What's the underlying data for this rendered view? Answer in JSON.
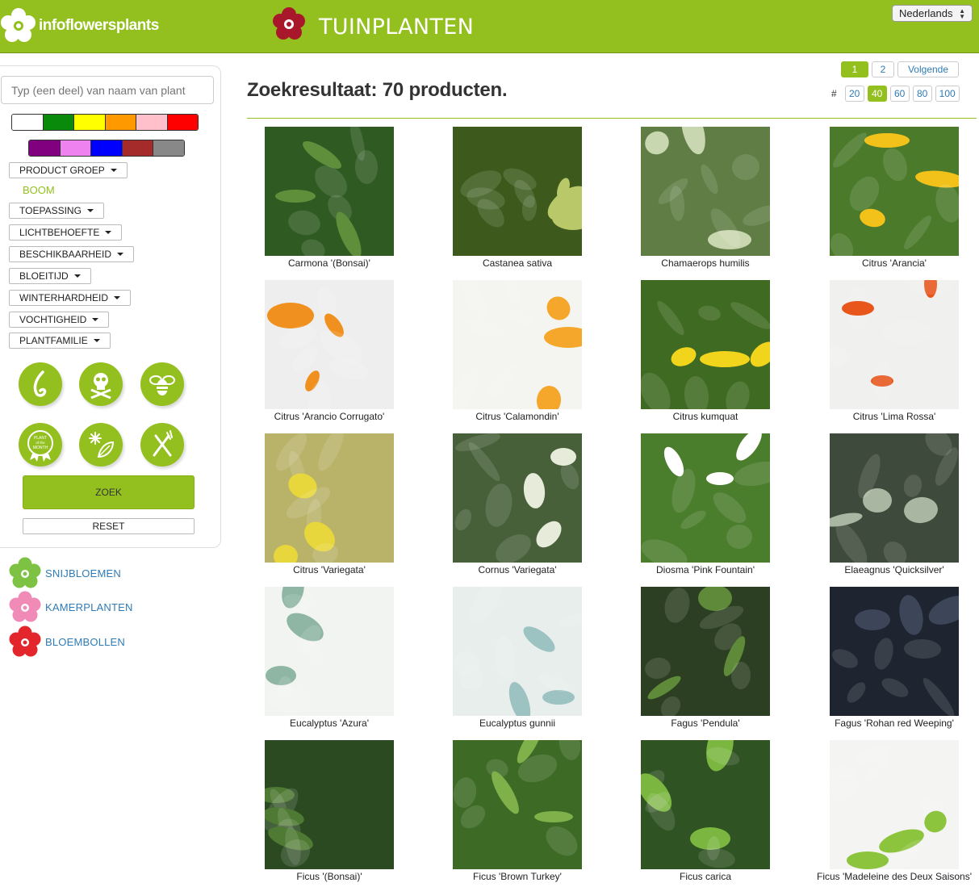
{
  "header": {
    "logo_text": "infoflowersplants",
    "page_title": "TUINPLANTEN",
    "language": "Nederlands"
  },
  "sidebar": {
    "search_placeholder": "Typ (een deel) van naam van plant",
    "colors_row1": [
      "#ffffff",
      "#0a8a0a",
      "#ffff00",
      "#ff9900",
      "#ffc0cb",
      "#ff0000"
    ],
    "colors_row2": [
      "#800080",
      "#ee82ee",
      "#0000ff",
      "#a52a2a",
      "#888888"
    ],
    "filters": [
      {
        "label": "PRODUCT GROEP"
      },
      {
        "label": "TOEPASSING"
      },
      {
        "label": "LICHTBEHOEFTE"
      },
      {
        "label": "BESCHIKBAARHEID"
      },
      {
        "label": "BLOEITIJD"
      },
      {
        "label": "WINTERHARDHEID"
      },
      {
        "label": "VOCHTIGHEID"
      },
      {
        "label": "PLANTFAMILIE"
      }
    ],
    "selected_group": "BOOM",
    "feature_icons": [
      "scent-icon",
      "poison-icon",
      "bee-icon",
      "plant-of-the-month-icon",
      "winter-leaf-icon",
      "edible-icon"
    ],
    "plant_of_month_text": [
      "PLANT",
      "of the",
      "MONTH"
    ],
    "zoek_label": "ZOEK",
    "reset_label": "RESET"
  },
  "categories": [
    {
      "label": "SNIJBLOEMEN",
      "color": "#7dc242"
    },
    {
      "label": "KAMERPLANTEN",
      "color": "#f08bb8"
    },
    {
      "label": "BLOEMBOLLEN",
      "color": "#e3262b"
    }
  ],
  "main": {
    "result_title": "Zoekresultaat: 70 producten.",
    "pages": [
      "1",
      "2"
    ],
    "next_label": "Volgende",
    "perpage_hash": "#",
    "perpage_options": [
      "20",
      "40",
      "60",
      "80",
      "100"
    ],
    "perpage_selected": "40",
    "products": [
      {
        "name": "Carmona '(Bonsai)'",
        "bg": "#2f5a22",
        "accent": "#5f8f3a"
      },
      {
        "name": "Castanea sativa",
        "bg": "#3d5a1c",
        "accent": "#b9c96a"
      },
      {
        "name": "Chamaerops humilis",
        "bg": "#5f7d44",
        "accent": "#c9d7b0"
      },
      {
        "name": "Citrus 'Arancia'",
        "bg": "#4b7a2a",
        "accent": "#f2c21b"
      },
      {
        "name": "Citrus 'Arancio Corrugato'",
        "bg": "#eeeeee",
        "accent": "#f0901e"
      },
      {
        "name": "Citrus 'Calamondin'",
        "bg": "#f4f4f0",
        "accent": "#f4a72a"
      },
      {
        "name": "Citrus kumquat",
        "bg": "#3f6a22",
        "accent": "#f1d51c"
      },
      {
        "name": "Citrus 'Lima Rossa'",
        "bg": "#f0f0ee",
        "accent": "#e8561c"
      },
      {
        "name": "Citrus 'Variegata'",
        "bg": "#b9b36a",
        "accent": "#e7d63c"
      },
      {
        "name": "Cornus 'Variegata'",
        "bg": "#47603a",
        "accent": "#e6ecd9"
      },
      {
        "name": "Diosma 'Pink Fountain'",
        "bg": "#4a7d2c",
        "accent": "#ffffff"
      },
      {
        "name": "Elaeagnus 'Quicksilver'",
        "bg": "#3e4a3c",
        "accent": "#a9b6a2"
      },
      {
        "name": "Eucalyptus 'Azura'",
        "bg": "#f2f4f2",
        "accent": "#8fb5a4"
      },
      {
        "name": "Eucalyptus gunnii",
        "bg": "#e8eeec",
        "accent": "#9cc3c2"
      },
      {
        "name": "Fagus 'Pendula'",
        "bg": "#2c3f22",
        "accent": "#5e8a3a"
      },
      {
        "name": "Fagus 'Rohan red Weeping'",
        "bg": "#1e2530",
        "accent": "#3d4658"
      },
      {
        "name": "Ficus '(Bonsai)'",
        "bg": "#2c4a22",
        "accent": "#4e7a33"
      },
      {
        "name": "Ficus 'Brown Turkey'",
        "bg": "#3d6a24",
        "accent": "#7fb04a"
      },
      {
        "name": "Ficus carica",
        "bg": "#2f5322",
        "accent": "#7ab640"
      },
      {
        "name": "Ficus 'Madeleine des Deux Saisons'",
        "bg": "#f4f4f2",
        "accent": "#8cc43e"
      }
    ]
  }
}
